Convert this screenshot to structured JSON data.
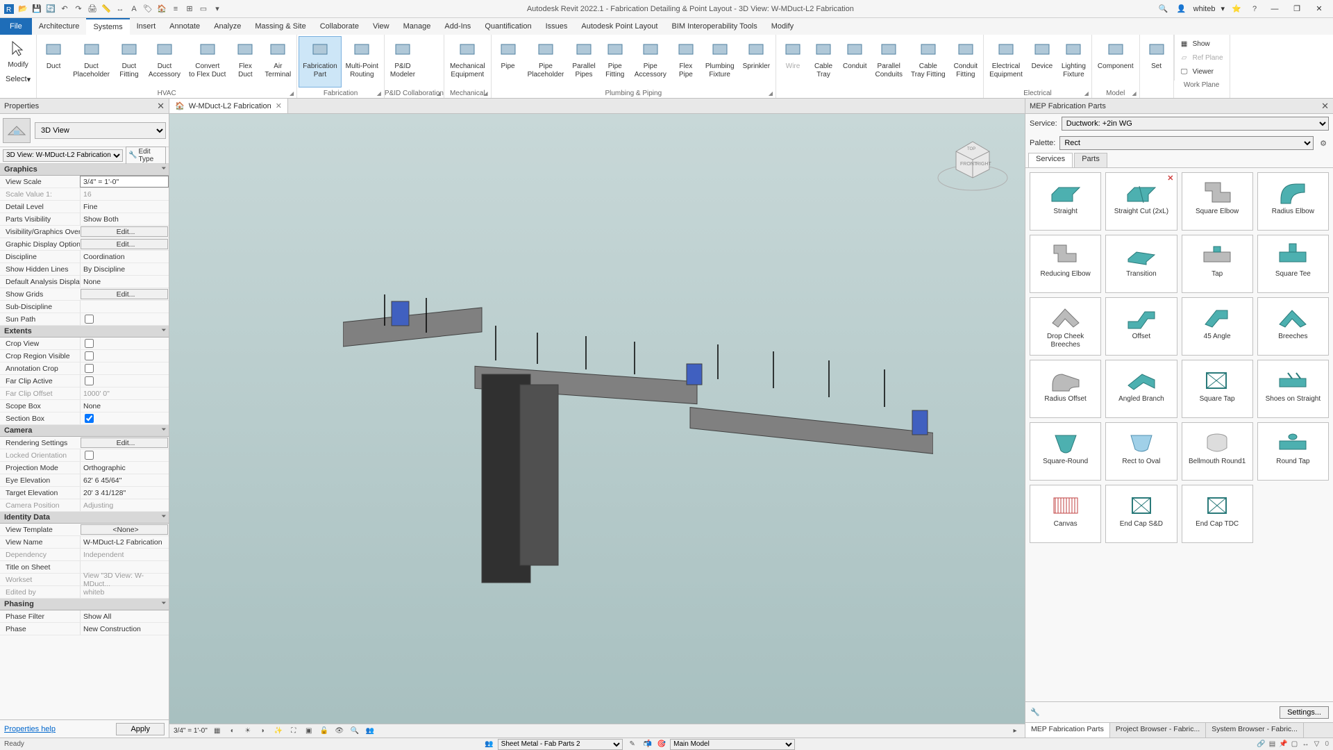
{
  "app": {
    "title": "Autodesk Revit 2022.1 - Fabrication Detailing & Point Layout - 3D View: W-MDuct-L2 Fabrication",
    "user": "whiteb"
  },
  "tabs": {
    "file": "File",
    "items": [
      "Architecture",
      "Systems",
      "Insert",
      "Annotate",
      "Analyze",
      "Massing & Site",
      "Collaborate",
      "View",
      "Manage",
      "Add-Ins",
      "Quantification",
      "Issues",
      "Autodesk Point Layout",
      "BIM Interoperability Tools",
      "Modify"
    ],
    "active": "Systems"
  },
  "ribbon": {
    "modify": "Modify",
    "select": "Select",
    "groups": [
      {
        "label": "HVAC",
        "buttons": [
          "Duct",
          "Duct Placeholder",
          "Duct Fitting",
          "Duct Accessory",
          "Convert to Flex Duct",
          "Flex Duct",
          "Air Terminal"
        ]
      },
      {
        "label": "Fabrication",
        "buttons": [
          "Fabrication Part",
          "Multi-Point Routing"
        ]
      },
      {
        "label": "P&ID Collaboration",
        "buttons": [
          "P&ID Modeler"
        ]
      },
      {
        "label": "Mechanical",
        "buttons": [
          "Mechanical Equipment"
        ]
      },
      {
        "label": "Plumbing & Piping",
        "buttons": [
          "Pipe",
          "Pipe Placeholder",
          "Parallel Pipes",
          "Pipe Fitting",
          "Pipe Accessory",
          "Flex Pipe",
          "Plumbing Fixture",
          "Sprinkler"
        ]
      },
      {
        "label": "",
        "buttons": [
          "Wire",
          "Cable Tray",
          "Conduit",
          "Parallel Conduits",
          "Cable Tray Fitting",
          "Conduit Fitting"
        ]
      },
      {
        "label": "Electrical",
        "buttons": [
          "Electrical Equipment",
          "Device",
          "Lighting Fixture"
        ]
      },
      {
        "label": "Model",
        "buttons": [
          "Component"
        ]
      },
      {
        "label": "",
        "buttons": [
          "Set"
        ]
      }
    ],
    "workplane": {
      "label": "Work Plane",
      "items": [
        "Show",
        "Ref Plane",
        "Viewer"
      ]
    },
    "active_btn": "Fabrication Part"
  },
  "properties": {
    "title": "Properties",
    "type_selector": "3D View",
    "instance": "3D View: W-MDuct-L2 Fabrication",
    "edit_type": "Edit Type",
    "help": "Properties help",
    "apply": "Apply",
    "groups": [
      {
        "name": "Graphics",
        "rows": [
          {
            "l": "View Scale",
            "v": "3/4\" = 1'-0\"",
            "t": "select"
          },
          {
            "l": "Scale Value    1:",
            "v": "16",
            "d": true
          },
          {
            "l": "Detail Level",
            "v": "Fine"
          },
          {
            "l": "Parts Visibility",
            "v": "Show Both"
          },
          {
            "l": "Visibility/Graphics Overri...",
            "v": "Edit...",
            "t": "btn"
          },
          {
            "l": "Graphic Display Options",
            "v": "Edit...",
            "t": "btn"
          },
          {
            "l": "Discipline",
            "v": "Coordination"
          },
          {
            "l": "Show Hidden Lines",
            "v": "By Discipline"
          },
          {
            "l": "Default Analysis Display ...",
            "v": "None"
          },
          {
            "l": "Show Grids",
            "v": "Edit...",
            "t": "btn"
          },
          {
            "l": "Sub-Discipline",
            "v": ""
          },
          {
            "l": "Sun Path",
            "v": "",
            "t": "check",
            "c": false
          }
        ]
      },
      {
        "name": "Extents",
        "rows": [
          {
            "l": "Crop View",
            "v": "",
            "t": "check",
            "c": false
          },
          {
            "l": "Crop Region Visible",
            "v": "",
            "t": "check",
            "c": false
          },
          {
            "l": "Annotation Crop",
            "v": "",
            "t": "check",
            "c": false
          },
          {
            "l": "Far Clip Active",
            "v": "",
            "t": "check",
            "c": false
          },
          {
            "l": "Far Clip Offset",
            "v": "1000'  0\"",
            "d": true
          },
          {
            "l": "Scope Box",
            "v": "None"
          },
          {
            "l": "Section Box",
            "v": "",
            "t": "check",
            "c": true
          }
        ]
      },
      {
        "name": "Camera",
        "rows": [
          {
            "l": "Rendering Settings",
            "v": "Edit...",
            "t": "btn"
          },
          {
            "l": "Locked Orientation",
            "v": "",
            "t": "check",
            "c": false,
            "d": true
          },
          {
            "l": "Projection Mode",
            "v": "Orthographic"
          },
          {
            "l": "Eye Elevation",
            "v": "62'  6 45/64\""
          },
          {
            "l": "Target Elevation",
            "v": "20'  3 41/128\""
          },
          {
            "l": "Camera Position",
            "v": "Adjusting",
            "d": true
          }
        ]
      },
      {
        "name": "Identity Data",
        "rows": [
          {
            "l": "View Template",
            "v": "<None>",
            "t": "btn"
          },
          {
            "l": "View Name",
            "v": "W-MDuct-L2 Fabrication"
          },
          {
            "l": "Dependency",
            "v": "Independent",
            "d": true
          },
          {
            "l": "Title on Sheet",
            "v": ""
          },
          {
            "l": "Workset",
            "v": "View \"3D View: W-MDuct...",
            "d": true
          },
          {
            "l": "Edited by",
            "v": "whiteb",
            "d": true
          }
        ]
      },
      {
        "name": "Phasing",
        "rows": [
          {
            "l": "Phase Filter",
            "v": "Show All"
          },
          {
            "l": "Phase",
            "v": "New Construction"
          }
        ]
      }
    ]
  },
  "view": {
    "tab": "W-MDuct-L2 Fabrication",
    "scale": "3/4\" = 1'-0\""
  },
  "fab": {
    "title": "MEP Fabrication Parts",
    "service_label": "Service:",
    "service": "Ductwork: +2in WG",
    "palette_label": "Palette:",
    "palette": "Rect",
    "tabs": [
      "Services",
      "Parts"
    ],
    "active_tab": "Services",
    "parts": [
      "Straight",
      "Straight Cut (2xL)",
      "Square Elbow",
      "Radius Elbow",
      "Reducing Elbow",
      "Transition",
      "Tap",
      "Square Tee",
      "Drop Cheek Breeches",
      "Offset",
      "45 Angle",
      "Breeches",
      "Radius Offset",
      "Angled Branch",
      "Square Tap",
      "Shoes on Straight",
      "Square-Round",
      "Rect to Oval",
      "Bellmouth Round1",
      "Round Tap",
      "Canvas",
      "End Cap S&D",
      "End Cap TDC"
    ],
    "settings": "Settings...",
    "bottom_tabs": [
      "MEP Fabrication Parts",
      "Project Browser - Fabric...",
      "System Browser - Fabric..."
    ]
  },
  "status": {
    "ready": "Ready",
    "sheet": "Sheet Metal - Fab Parts 2",
    "model": "Main Model"
  }
}
